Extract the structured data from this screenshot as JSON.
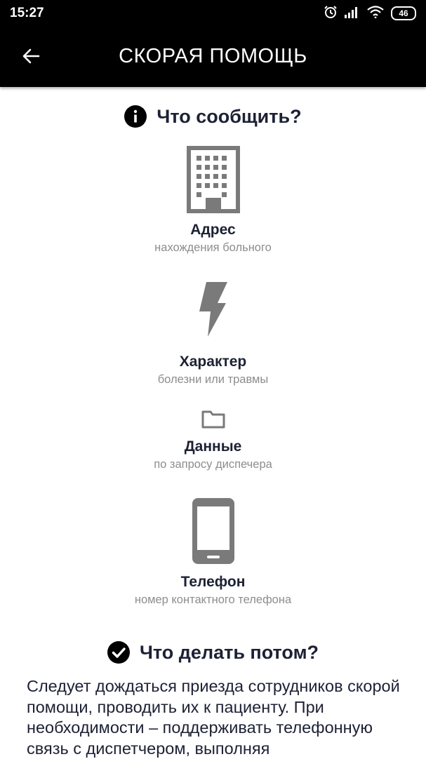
{
  "status_bar": {
    "time": "15:27",
    "battery": "46",
    "icons": [
      "alarm-icon",
      "signal-icon",
      "wifi-icon",
      "battery-icon"
    ]
  },
  "app_bar": {
    "title": "СКОРАЯ ПОМОЩЬ",
    "back_icon": "arrow-left-icon"
  },
  "section_what_to_report": {
    "title": "Что сообщить?",
    "icon": "info-icon"
  },
  "items": [
    {
      "icon": "building-icon",
      "title": "Адрес",
      "subtitle": "нахождения больного"
    },
    {
      "icon": "lightning-icon",
      "title": "Характер",
      "subtitle": "болезни или травмы"
    },
    {
      "icon": "folder-icon",
      "title": "Данные",
      "subtitle": "по запросу диспечера"
    },
    {
      "icon": "phone-icon",
      "title": "Телефон",
      "subtitle": "номер контактного телефона"
    }
  ],
  "section_what_next": {
    "title": "Что делать потом?",
    "icon": "check-circle-icon",
    "text": "Следует дождаться приезда сотрудников скорой помощи, проводить их к пациенту. При необходимости – поддерживать телефонную связь с диспетчером, выполняя"
  },
  "colors": {
    "bar": "#000000",
    "heading": "#1d2134",
    "subtitle": "#8d8d8d",
    "icon_gray": "#7a7a7a"
  }
}
